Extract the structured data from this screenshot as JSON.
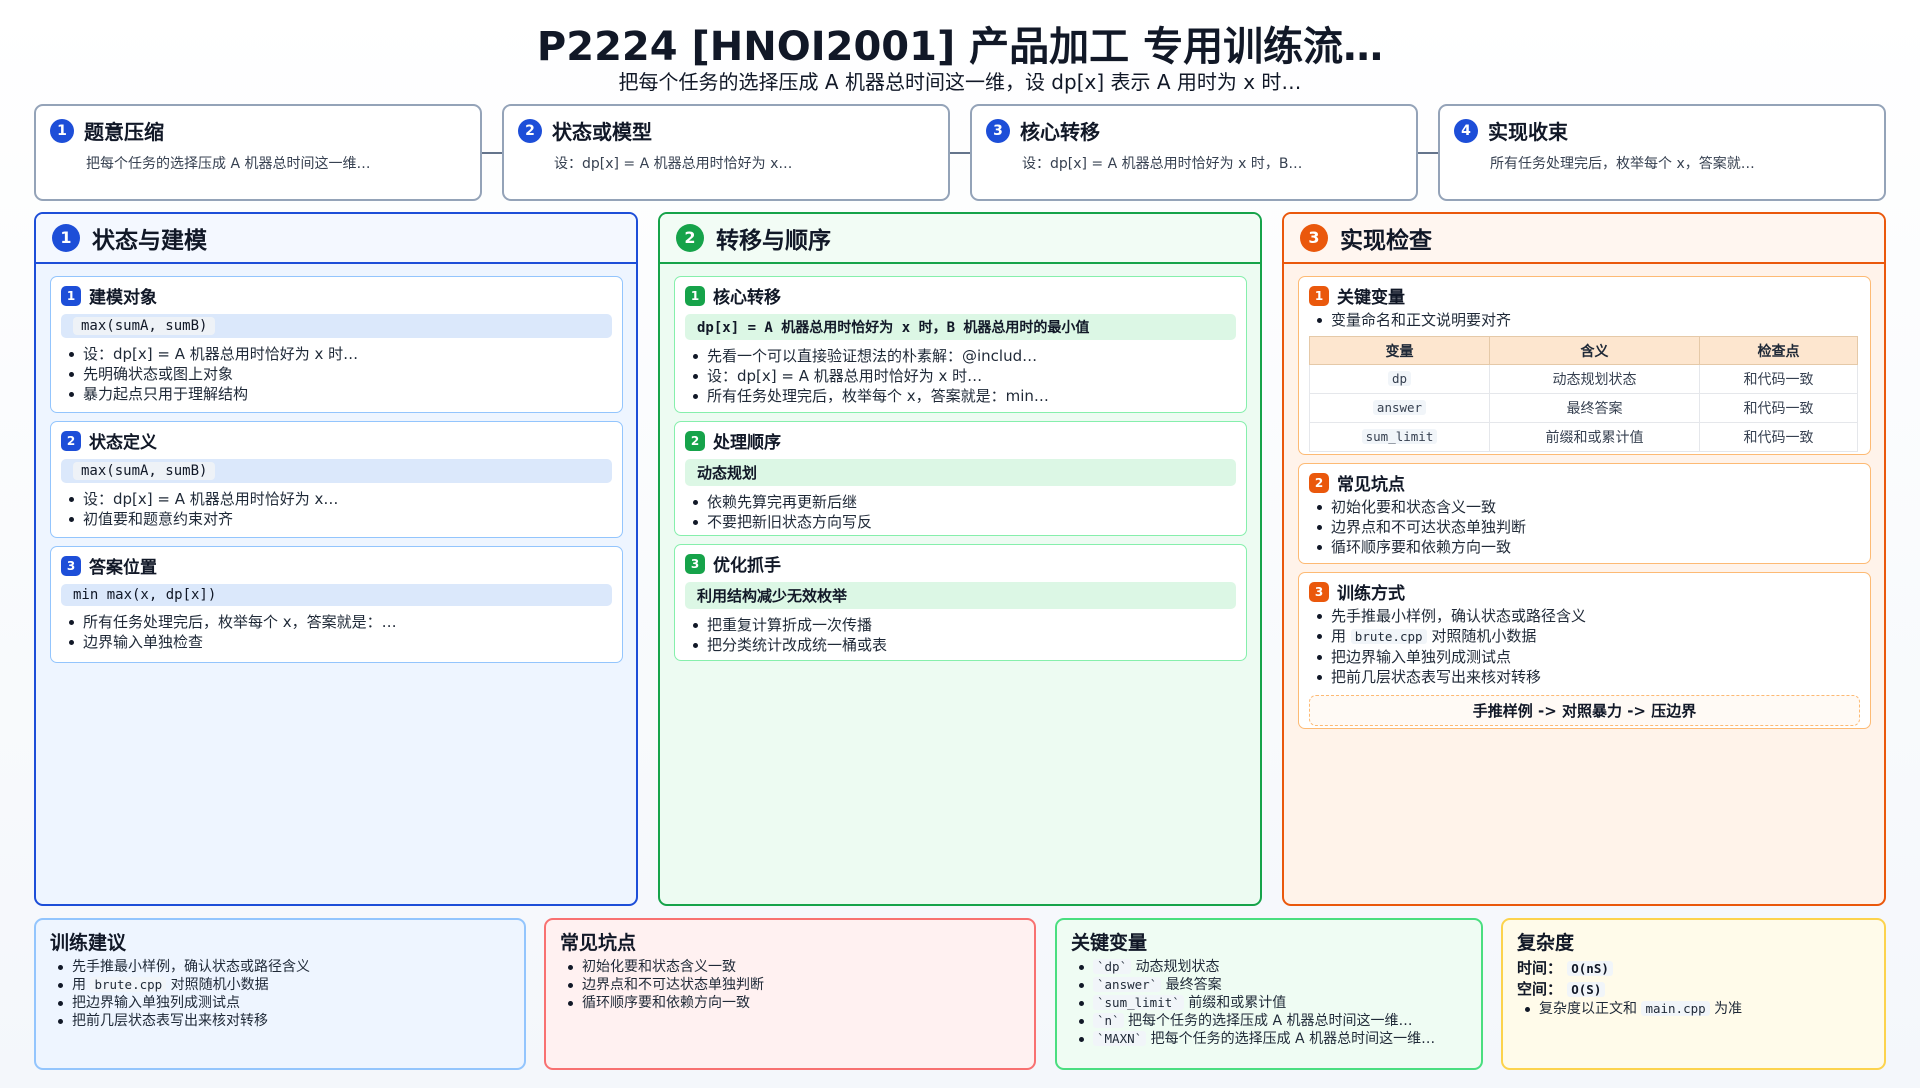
{
  "header": {
    "title": "P2224 [HNOI2001] 产品加工 专用训练流…",
    "subtitle": "把每个任务的选择压成 A 机器总时间这一维，设 dp[x] 表示 A 用时为 x 时…"
  },
  "steps": [
    {
      "num": "1",
      "title": "题意压缩",
      "desc": "把每个任务的选择压成 A 机器总时间这一维…"
    },
    {
      "num": "2",
      "title": "状态或模型",
      "desc": "设：dp[x] = A 机器总用时恰好为 x…"
    },
    {
      "num": "3",
      "title": "核心转移",
      "desc": "设：dp[x] = A 机器总用时恰好为 x 时，B…"
    },
    {
      "num": "4",
      "title": "实现收束",
      "desc": "所有任务处理完后，枚举每个 x，答案就…"
    }
  ],
  "col1": {
    "num": "1",
    "title": "状态与建模",
    "cards": [
      {
        "num": "1",
        "title": "建模对象",
        "code": "max(sumA, sumB)",
        "items": [
          "设：dp[x] = A 机器总用时恰好为 x 时…",
          "先明确状态或图上对象",
          "暴力起点只用于理解结构"
        ]
      },
      {
        "num": "2",
        "title": "状态定义",
        "code": "max(sumA, sumB)",
        "items": [
          "设：dp[x] = A 机器总用时恰好为 x…",
          "初值要和题意约束对齐"
        ]
      },
      {
        "num": "3",
        "title": "答案位置",
        "code": "min max(x, dp[x])",
        "items": [
          "所有任务处理完后，枚举每个 x，答案就是：…",
          "边界输入单独检查"
        ]
      }
    ]
  },
  "col2": {
    "num": "2",
    "title": "转移与顺序",
    "cards": [
      {
        "num": "1",
        "title": "核心转移",
        "code": "dp[x] = A 机器总用时恰好为 x 时，B 机器总用时的最小值",
        "items": [
          "先看一个可以直接验证想法的朴素解：@includ…",
          "设：dp[x] = A 机器总用时恰好为 x 时…",
          "所有任务处理完后，枚举每个 x，答案就是：min…"
        ]
      },
      {
        "num": "2",
        "title": "处理顺序",
        "code": "动态规划",
        "items": [
          "依赖先算完再更新后继",
          "不要把新旧状态方向写反"
        ]
      },
      {
        "num": "3",
        "title": "优化抓手",
        "code": "利用结构减少无效枚举",
        "items": [
          "把重复计算折成一次传播",
          "把分类统计改成统一桶或表"
        ]
      }
    ]
  },
  "col3": {
    "num": "3",
    "title": "实现检查",
    "vars": {
      "num": "1",
      "title": "关键变量",
      "note": "变量命名和正文说明要对齐",
      "headers": [
        "变量",
        "含义",
        "检查点"
      ],
      "rows": [
        [
          "dp",
          "动态规划状态",
          "和代码一致"
        ],
        [
          "answer",
          "最终答案",
          "和代码一致"
        ],
        [
          "sum_limit",
          "前缀和或累计值",
          "和代码一致"
        ]
      ]
    },
    "pitfalls": {
      "num": "2",
      "title": "常见坑点",
      "items": [
        "初始化要和状态含义一致",
        "边界点和不可达状态单独判断",
        "循环顺序要和依赖方向一致"
      ]
    },
    "training": {
      "num": "3",
      "title": "训练方式",
      "items_pre": "先手推最小样例，确认状态或路径含义",
      "item2_pre": "用",
      "item2_code": "brute.cpp",
      "item2_post": "对照随机小数据",
      "items_post": [
        "把边界输入单独列成测试点",
        "把前几层状态表写出来核对转移"
      ],
      "flow": "手推样例 -> 对照暴力 -> 压边界"
    }
  },
  "bottom": {
    "advice": {
      "title": "训练建议",
      "item1": "先手推最小样例，确认状态或路径含义",
      "item2_pre": "用",
      "item2_code": "brute.cpp",
      "item2_post": "对照随机小数据",
      "item3": "把边界输入单独列成测试点",
      "item4": "把前几层状态表写出来核对转移"
    },
    "pitfalls": {
      "title": "常见坑点",
      "items": [
        "初始化要和状态含义一致",
        "边界点和不可达状态单独判断",
        "循环顺序要和依赖方向一致"
      ]
    },
    "vars": {
      "title": "关键变量",
      "items": [
        {
          "code": "`dp`",
          "text": "动态规划状态"
        },
        {
          "code": "`answer`",
          "text": "最终答案"
        },
        {
          "code": "`sum_limit`",
          "text": "前缀和或累计值"
        },
        {
          "code": "`n`",
          "text": "把每个任务的选择压成 A 机器总时间这一维…"
        },
        {
          "code": "`MAXN`",
          "text": "把每个任务的选择压成 A 机器总时间这一维…"
        }
      ]
    },
    "complexity": {
      "title": "复杂度",
      "time_label": "时间：",
      "time": "O(nS)",
      "space_label": "空间：",
      "space": "O(S)",
      "note_pre": "复杂度以正文和",
      "note_code": "main.cpp",
      "note_post": "为准"
    }
  },
  "colors": {
    "blue": "#1d4ed8",
    "green": "#16a34a",
    "orange": "#ea580c",
    "red": "#f87171",
    "yellow": "#fcd34d"
  }
}
